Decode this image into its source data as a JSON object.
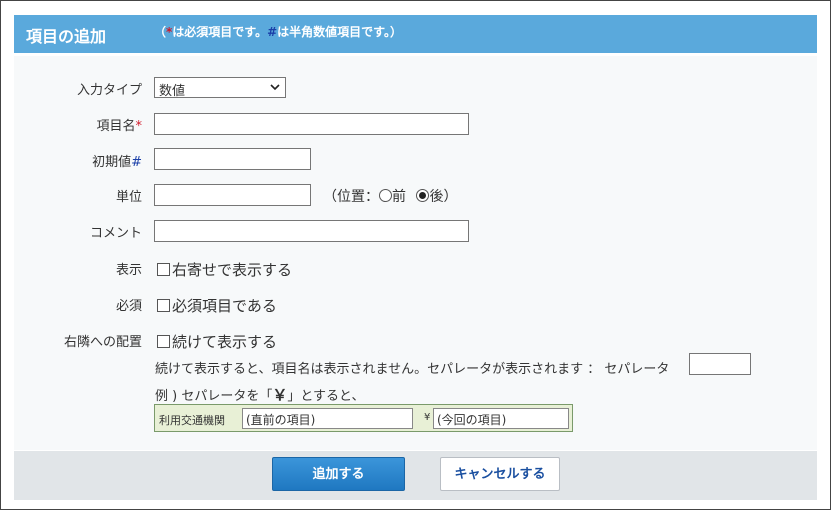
{
  "header": {
    "title": "項目の追加",
    "note_open": "（",
    "note_req_mark": "*",
    "note_req_text": "は必須項目です。",
    "note_hash_mark": "#",
    "note_hash_text": "は半角数値項目です。）"
  },
  "form": {
    "input_type": {
      "label": "入力タイプ",
      "value": "数値"
    },
    "item_name": {
      "label": "項目名",
      "mark": "*",
      "value": ""
    },
    "initial_value": {
      "label": "初期値",
      "mark": "#",
      "value": ""
    },
    "unit": {
      "label": "単位",
      "value": "",
      "position_open": "（位置：",
      "option_before": "前",
      "option_after": "後",
      "position_close": "）",
      "selected": "後"
    },
    "comment": {
      "label": "コメント",
      "value": ""
    },
    "display": {
      "label": "表示",
      "checkbox_label": "右寄せで表示する",
      "checked": false
    },
    "required": {
      "label": "必須",
      "checkbox_label": "必須項目である",
      "checked": false
    },
    "adjacent": {
      "label": "右隣への配置",
      "checkbox_label": "続けて表示する",
      "checked": false,
      "help_text": "続けて表示すると、項目名は表示されません。セパレータが表示されます ： セパレータ",
      "separator_value": "",
      "example_prefix": "例 ) セパレータを「",
      "example_symbol": "￥",
      "example_suffix": "」とすると、",
      "example": {
        "label": "利用交通機関",
        "field1": "(直前の項目)",
        "yen": "¥",
        "field2": "(今回の項目)"
      }
    }
  },
  "buttons": {
    "add": "追加する",
    "cancel": "キャンセルする"
  }
}
